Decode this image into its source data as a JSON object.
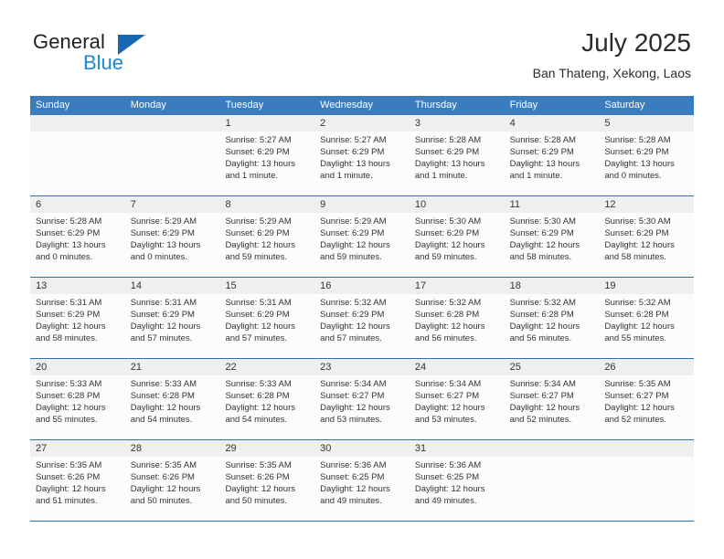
{
  "brand": {
    "name_part1": "General",
    "name_part2": "Blue",
    "triangle_icon": "blue-triangle-icon",
    "accent_color": "#1c87d4",
    "dark_color": "#231f20"
  },
  "header": {
    "title": "July 2025",
    "subtitle": "Ban Thateng, Xekong, Laos"
  },
  "calendar": {
    "header_bg": "#3b7cbf",
    "date_band_bg": "#efefef",
    "row_separator": "#2f6fb0",
    "weekdays": [
      "Sunday",
      "Monday",
      "Tuesday",
      "Wednesday",
      "Thursday",
      "Friday",
      "Saturday"
    ],
    "weeks": [
      [
        {
          "day": "",
          "lines": []
        },
        {
          "day": "",
          "lines": []
        },
        {
          "day": "1",
          "lines": [
            "Sunrise: 5:27 AM",
            "Sunset: 6:29 PM",
            "Daylight: 13 hours",
            "and 1 minute."
          ]
        },
        {
          "day": "2",
          "lines": [
            "Sunrise: 5:27 AM",
            "Sunset: 6:29 PM",
            "Daylight: 13 hours",
            "and 1 minute."
          ]
        },
        {
          "day": "3",
          "lines": [
            "Sunrise: 5:28 AM",
            "Sunset: 6:29 PM",
            "Daylight: 13 hours",
            "and 1 minute."
          ]
        },
        {
          "day": "4",
          "lines": [
            "Sunrise: 5:28 AM",
            "Sunset: 6:29 PM",
            "Daylight: 13 hours",
            "and 1 minute."
          ]
        },
        {
          "day": "5",
          "lines": [
            "Sunrise: 5:28 AM",
            "Sunset: 6:29 PM",
            "Daylight: 13 hours",
            "and 0 minutes."
          ]
        }
      ],
      [
        {
          "day": "6",
          "lines": [
            "Sunrise: 5:28 AM",
            "Sunset: 6:29 PM",
            "Daylight: 13 hours",
            "and 0 minutes."
          ]
        },
        {
          "day": "7",
          "lines": [
            "Sunrise: 5:29 AM",
            "Sunset: 6:29 PM",
            "Daylight: 13 hours",
            "and 0 minutes."
          ]
        },
        {
          "day": "8",
          "lines": [
            "Sunrise: 5:29 AM",
            "Sunset: 6:29 PM",
            "Daylight: 12 hours",
            "and 59 minutes."
          ]
        },
        {
          "day": "9",
          "lines": [
            "Sunrise: 5:29 AM",
            "Sunset: 6:29 PM",
            "Daylight: 12 hours",
            "and 59 minutes."
          ]
        },
        {
          "day": "10",
          "lines": [
            "Sunrise: 5:30 AM",
            "Sunset: 6:29 PM",
            "Daylight: 12 hours",
            "and 59 minutes."
          ]
        },
        {
          "day": "11",
          "lines": [
            "Sunrise: 5:30 AM",
            "Sunset: 6:29 PM",
            "Daylight: 12 hours",
            "and 58 minutes."
          ]
        },
        {
          "day": "12",
          "lines": [
            "Sunrise: 5:30 AM",
            "Sunset: 6:29 PM",
            "Daylight: 12 hours",
            "and 58 minutes."
          ]
        }
      ],
      [
        {
          "day": "13",
          "lines": [
            "Sunrise: 5:31 AM",
            "Sunset: 6:29 PM",
            "Daylight: 12 hours",
            "and 58 minutes."
          ]
        },
        {
          "day": "14",
          "lines": [
            "Sunrise: 5:31 AM",
            "Sunset: 6:29 PM",
            "Daylight: 12 hours",
            "and 57 minutes."
          ]
        },
        {
          "day": "15",
          "lines": [
            "Sunrise: 5:31 AM",
            "Sunset: 6:29 PM",
            "Daylight: 12 hours",
            "and 57 minutes."
          ]
        },
        {
          "day": "16",
          "lines": [
            "Sunrise: 5:32 AM",
            "Sunset: 6:29 PM",
            "Daylight: 12 hours",
            "and 57 minutes."
          ]
        },
        {
          "day": "17",
          "lines": [
            "Sunrise: 5:32 AM",
            "Sunset: 6:28 PM",
            "Daylight: 12 hours",
            "and 56 minutes."
          ]
        },
        {
          "day": "18",
          "lines": [
            "Sunrise: 5:32 AM",
            "Sunset: 6:28 PM",
            "Daylight: 12 hours",
            "and 56 minutes."
          ]
        },
        {
          "day": "19",
          "lines": [
            "Sunrise: 5:32 AM",
            "Sunset: 6:28 PM",
            "Daylight: 12 hours",
            "and 55 minutes."
          ]
        }
      ],
      [
        {
          "day": "20",
          "lines": [
            "Sunrise: 5:33 AM",
            "Sunset: 6:28 PM",
            "Daylight: 12 hours",
            "and 55 minutes."
          ]
        },
        {
          "day": "21",
          "lines": [
            "Sunrise: 5:33 AM",
            "Sunset: 6:28 PM",
            "Daylight: 12 hours",
            "and 54 minutes."
          ]
        },
        {
          "day": "22",
          "lines": [
            "Sunrise: 5:33 AM",
            "Sunset: 6:28 PM",
            "Daylight: 12 hours",
            "and 54 minutes."
          ]
        },
        {
          "day": "23",
          "lines": [
            "Sunrise: 5:34 AM",
            "Sunset: 6:27 PM",
            "Daylight: 12 hours",
            "and 53 minutes."
          ]
        },
        {
          "day": "24",
          "lines": [
            "Sunrise: 5:34 AM",
            "Sunset: 6:27 PM",
            "Daylight: 12 hours",
            "and 53 minutes."
          ]
        },
        {
          "day": "25",
          "lines": [
            "Sunrise: 5:34 AM",
            "Sunset: 6:27 PM",
            "Daylight: 12 hours",
            "and 52 minutes."
          ]
        },
        {
          "day": "26",
          "lines": [
            "Sunrise: 5:35 AM",
            "Sunset: 6:27 PM",
            "Daylight: 12 hours",
            "and 52 minutes."
          ]
        }
      ],
      [
        {
          "day": "27",
          "lines": [
            "Sunrise: 5:35 AM",
            "Sunset: 6:26 PM",
            "Daylight: 12 hours",
            "and 51 minutes."
          ]
        },
        {
          "day": "28",
          "lines": [
            "Sunrise: 5:35 AM",
            "Sunset: 6:26 PM",
            "Daylight: 12 hours",
            "and 50 minutes."
          ]
        },
        {
          "day": "29",
          "lines": [
            "Sunrise: 5:35 AM",
            "Sunset: 6:26 PM",
            "Daylight: 12 hours",
            "and 50 minutes."
          ]
        },
        {
          "day": "30",
          "lines": [
            "Sunrise: 5:36 AM",
            "Sunset: 6:25 PM",
            "Daylight: 12 hours",
            "and 49 minutes."
          ]
        },
        {
          "day": "31",
          "lines": [
            "Sunrise: 5:36 AM",
            "Sunset: 6:25 PM",
            "Daylight: 12 hours",
            "and 49 minutes."
          ]
        },
        {
          "day": "",
          "lines": []
        },
        {
          "day": "",
          "lines": []
        }
      ]
    ]
  }
}
